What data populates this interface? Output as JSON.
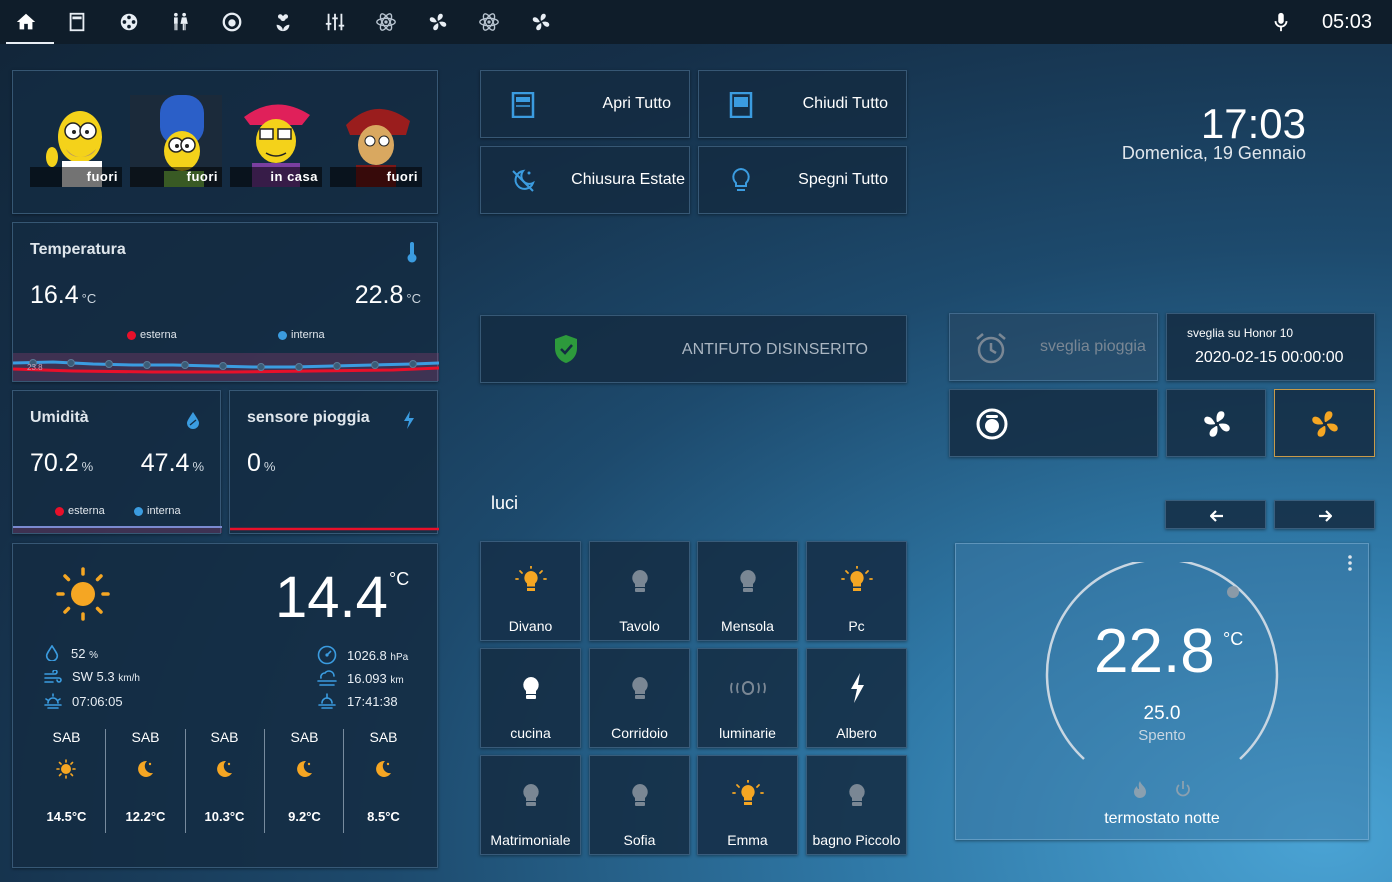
{
  "topbar": {
    "tabs": [
      "home-icon",
      "window-shutter-icon",
      "film-reel-icon",
      "human-male-female-icon",
      "robot-vacuum-icon",
      "flower-icon",
      "tune-sliders-icon",
      "atom-icon",
      "fan-icon",
      "atom-icon",
      "fan-icon"
    ],
    "time": "05:03"
  },
  "presence": {
    "people": [
      {
        "status": "fuori"
      },
      {
        "status": "fuori"
      },
      {
        "status": "in casa"
      },
      {
        "status": "fuori"
      }
    ]
  },
  "temperature": {
    "title": "Temperatura",
    "external_value": "16.4",
    "internal_value": "22.8",
    "unit": "°C",
    "legend_external": "esterna",
    "legend_internal": "interna",
    "min_label": "23.8"
  },
  "humidity": {
    "title": "Umidità",
    "external_value": "70.2",
    "internal_value": "47.4",
    "unit": "%",
    "legend_external": "esterna",
    "legend_internal": "interna"
  },
  "rain": {
    "title": "sensore pioggia",
    "value": "0",
    "unit": "%"
  },
  "weather": {
    "temperature": "14.4",
    "unit": "°C",
    "humidity": "52",
    "humidity_unit": "%",
    "wind": "SW 5.3",
    "wind_unit": "km/h",
    "sunrise": "07:06:05",
    "pressure": "1026.8",
    "pressure_unit": "hPa",
    "visibility": "16.093",
    "visibility_unit": "km",
    "sunset": "17:41:38",
    "forecast": [
      {
        "day": "SAB",
        "temp": "14.5°C",
        "icon": "sun-icon"
      },
      {
        "day": "SAB",
        "temp": "12.2°C",
        "icon": "moon-icon"
      },
      {
        "day": "SAB",
        "temp": "10.3°C",
        "icon": "moon-icon"
      },
      {
        "day": "SAB",
        "temp": "9.2°C",
        "icon": "moon-icon"
      },
      {
        "day": "SAB",
        "temp": "8.5°C",
        "icon": "moon-icon"
      }
    ]
  },
  "actions": {
    "open_all": "Apri Tutto",
    "close_all": "Chiudi Tutto",
    "summer_close": "Chiusura Estate",
    "lights_off": "Spegni Tutto"
  },
  "antifurto": {
    "label": "ANTIFUTO DISINSERITO"
  },
  "lights": {
    "title": "luci",
    "items": [
      {
        "name": "Divano",
        "on": true
      },
      {
        "name": "Tavolo",
        "on": false
      },
      {
        "name": "Mensola",
        "on": false
      },
      {
        "name": "Pc",
        "on": true
      },
      {
        "name": "cucina",
        "on": true
      },
      {
        "name": "Corridoio",
        "on": false
      },
      {
        "name": "luminarie",
        "on": false
      },
      {
        "name": "Albero",
        "on": true
      },
      {
        "name": "Matrimoniale",
        "on": false
      },
      {
        "name": "Sofia",
        "on": false
      },
      {
        "name": "Emma",
        "on": true
      },
      {
        "name": "bagno Piccolo",
        "on": false
      }
    ]
  },
  "clock": {
    "time": "17:03",
    "date": "Domenica, 19 Gennaio"
  },
  "alarm": {
    "rain_alarm": "sveglia pioggia",
    "phone_alarm_label": "sveglia su Honor 10",
    "phone_alarm_value": "2020-02-15 00:00:00"
  },
  "thermostat": {
    "current": "22.8",
    "unit": "°C",
    "target": "25.0",
    "state": "Spento",
    "name": "termostato notte"
  },
  "colors": {
    "accent_orange": "#f5a623",
    "external_red": "#e8102a",
    "internal_blue": "#3b9ce0"
  }
}
